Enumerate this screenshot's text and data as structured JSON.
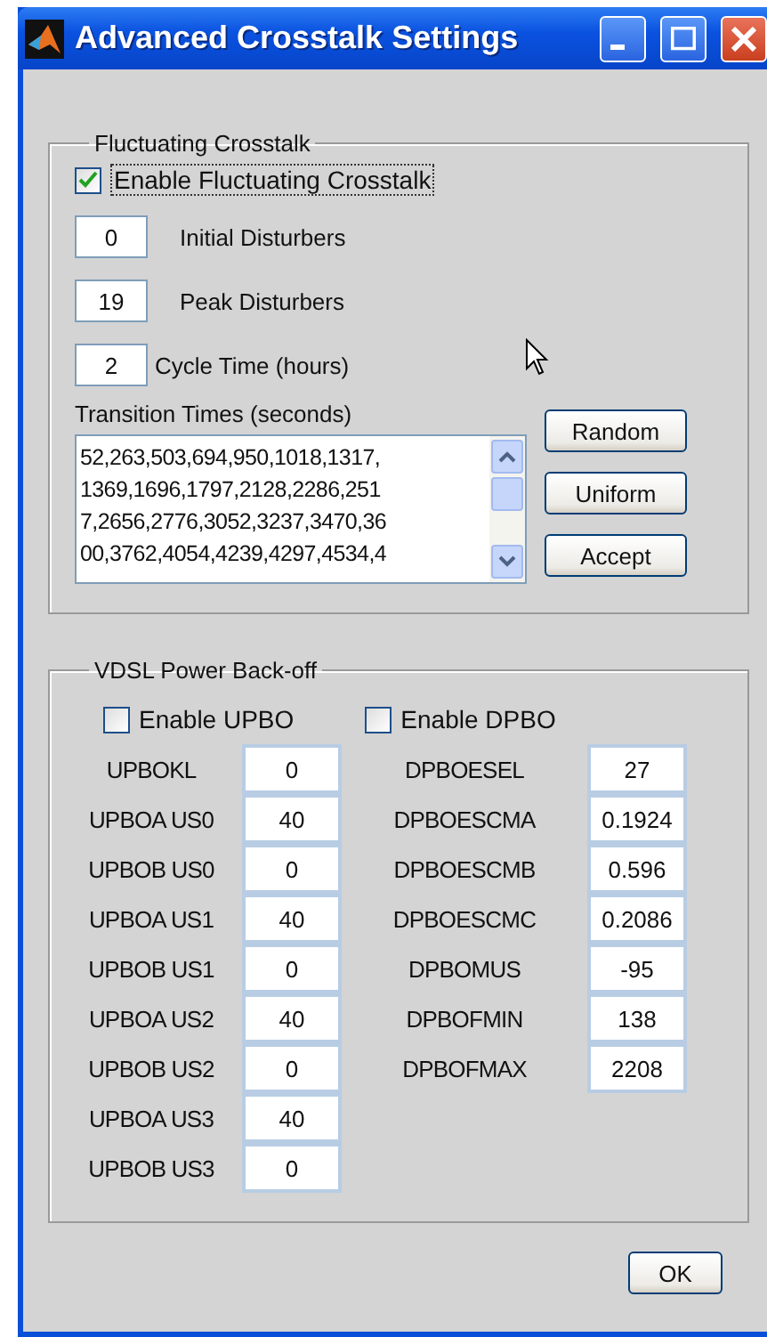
{
  "window": {
    "title": "Advanced Crosstalk Settings"
  },
  "fluctuating": {
    "legend": "Fluctuating Crosstalk",
    "enable": {
      "label": "Enable Fluctuating Crosstalk",
      "checked": true
    },
    "fields": [
      {
        "value": "0",
        "label": "Initial Disturbers"
      },
      {
        "value": "19",
        "label": "Peak Disturbers"
      },
      {
        "value": "2",
        "label": "Cycle Time (hours)"
      }
    ],
    "transition": {
      "label": "Transition Times (seconds)",
      "lines": [
        "52,263,503,694,950,1018,1317,",
        "1369,1696,1797,2128,2286,251",
        "7,2656,2776,3052,3237,3470,36",
        "00,3762,4054,4239,4297,4534,4"
      ]
    },
    "buttons": [
      "Random",
      "Uniform",
      "Accept"
    ]
  },
  "vdsl": {
    "legend": "VDSL Power Back-off",
    "upbo": {
      "label": "Enable UPBO",
      "checked": false
    },
    "dpbo": {
      "label": "Enable DPBO",
      "checked": false
    },
    "upbo_fields": [
      {
        "label": "UPBOKL",
        "value": "0"
      },
      {
        "label": "UPBOA US0",
        "value": "40"
      },
      {
        "label": "UPBOB US0",
        "value": "0"
      },
      {
        "label": "UPBOA US1",
        "value": "40"
      },
      {
        "label": "UPBOB US1",
        "value": "0"
      },
      {
        "label": "UPBOA US2",
        "value": "40"
      },
      {
        "label": "UPBOB US2",
        "value": "0"
      },
      {
        "label": "UPBOA US3",
        "value": "40"
      },
      {
        "label": "UPBOB US3",
        "value": "0"
      }
    ],
    "dpbo_fields": [
      {
        "label": "DPBOESEL",
        "value": "27"
      },
      {
        "label": "DPBOESCMA",
        "value": "0.1924"
      },
      {
        "label": "DPBOESCMB",
        "value": "0.596"
      },
      {
        "label": "DPBOESCMC",
        "value": "0.2086"
      },
      {
        "label": "DPBOMUS",
        "value": "-95"
      },
      {
        "label": "DPBOFMIN",
        "value": "138"
      },
      {
        "label": "DPBOFMAX",
        "value": "2208"
      }
    ]
  },
  "ok_button": "OK"
}
